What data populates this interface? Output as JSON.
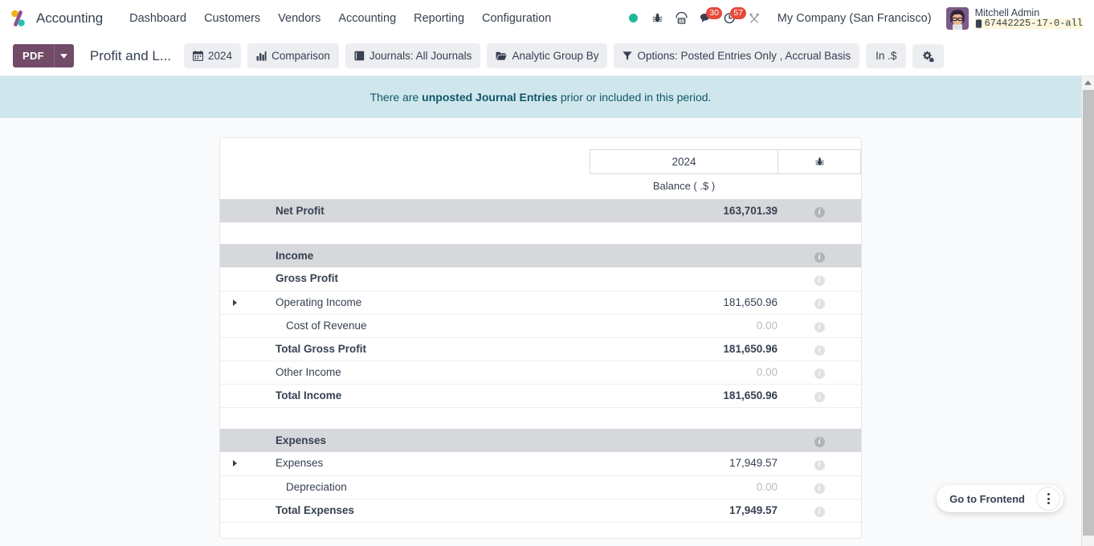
{
  "navbar": {
    "brand": "Accounting",
    "logo_icon": "odoo-logo-icon",
    "menu": [
      {
        "label": "Dashboard"
      },
      {
        "label": "Customers"
      },
      {
        "label": "Vendors"
      },
      {
        "label": "Accounting"
      },
      {
        "label": "Reporting"
      },
      {
        "label": "Configuration"
      }
    ],
    "sys_icons": [
      {
        "name": "status-online-dot",
        "glyph": "dot"
      },
      {
        "name": "bug-icon",
        "glyph": "bug"
      },
      {
        "name": "voip-phone-icon",
        "glyph": "phone"
      },
      {
        "name": "messages-icon",
        "glyph": "chat",
        "badge": "30"
      },
      {
        "name": "activities-icon",
        "glyph": "clock",
        "badge": "57"
      },
      {
        "name": "tools-icon",
        "glyph": "tools"
      }
    ],
    "company": "My Company (San Francisco)",
    "user_name": "Mitchell Admin",
    "database": "67442225-17-0-all",
    "db_icon": "database-icon"
  },
  "control_panel": {
    "pdf_label": "PDF",
    "pdf_caret_icon": "chevron-down-icon",
    "report_title": "Profit and L...",
    "buttons": [
      {
        "name": "date-filter-button",
        "icon": "calendar-icon",
        "label": "2024"
      },
      {
        "name": "comparison-button",
        "icon": "bar-chart-icon",
        "label": "Comparison"
      },
      {
        "name": "journals-filter-button",
        "icon": "book-icon",
        "label": "Journals: All Journals"
      },
      {
        "name": "analytic-group-by-button",
        "icon": "folder-icon",
        "label": "Analytic Group By"
      },
      {
        "name": "options-filter-button",
        "icon": "funnel-icon",
        "label": "Options: Posted Entries Only , Accrual Basis"
      }
    ],
    "currency_button": "In .$",
    "settings_icon": "gears-icon"
  },
  "alert": {
    "prefix": "There are ",
    "strong": "unposted Journal Entries",
    "suffix": " prior or included in this period."
  },
  "report": {
    "column_header": "2024",
    "debug_icon": "bug-icon",
    "balance_label": "Balance ( .$ )",
    "info_icon": "info-icon",
    "expand_icon": "caret-right-icon",
    "rows": [
      {
        "type": "row",
        "style": "shaded bold",
        "indent": 0,
        "caret": false,
        "name": "Net Profit",
        "value": "163,701.39",
        "info": "solid"
      },
      {
        "type": "spacer"
      },
      {
        "type": "row",
        "style": "shaded bold",
        "indent": 0,
        "caret": false,
        "name": "Income",
        "value": "",
        "info": "solid"
      },
      {
        "type": "row",
        "style": "bold",
        "indent": 1,
        "caret": false,
        "name": "Gross Profit",
        "value": "",
        "info": "light"
      },
      {
        "type": "row",
        "style": "line topline",
        "indent": 1,
        "caret": true,
        "name": "Operating Income",
        "value": "181,650.96",
        "info": "light"
      },
      {
        "type": "row",
        "style": "line muted",
        "indent": 2,
        "caret": false,
        "name": "Cost of Revenue",
        "value": "0.00",
        "info": "light"
      },
      {
        "type": "row",
        "style": "line bold",
        "indent": 0,
        "caret": false,
        "name": "Total Gross Profit",
        "value": "181,650.96",
        "info": "light"
      },
      {
        "type": "row",
        "style": "line muted",
        "indent": 1,
        "caret": false,
        "name": "Other Income",
        "value": "0.00",
        "info": "light"
      },
      {
        "type": "row",
        "style": "line bold",
        "indent": 0,
        "caret": false,
        "name": "Total Income",
        "value": "181,650.96",
        "info": "light"
      },
      {
        "type": "spacer"
      },
      {
        "type": "row",
        "style": "shaded bold",
        "indent": 0,
        "caret": false,
        "name": "Expenses",
        "value": "",
        "info": "solid"
      },
      {
        "type": "row",
        "style": "line",
        "indent": 1,
        "caret": true,
        "name": "Expenses",
        "value": "17,949.57",
        "info": "light"
      },
      {
        "type": "row",
        "style": "line muted",
        "indent": 2,
        "caret": false,
        "name": "Depreciation",
        "value": "0.00",
        "info": "light"
      },
      {
        "type": "row",
        "style": "line bold",
        "indent": 0,
        "caret": false,
        "name": "Total Expenses",
        "value": "17,949.57",
        "info": "light"
      }
    ]
  },
  "frontend_pill": {
    "label": "Go to Frontend",
    "menu_icon": "kebab-menu-icon"
  },
  "colors": {
    "brand_purple": "#714b67",
    "alert_bg": "#cfe7ec",
    "alert_text": "#10566a",
    "badge_red": "#e5493a",
    "online_green": "#21b799",
    "row_shade": "#d6d8dc"
  }
}
